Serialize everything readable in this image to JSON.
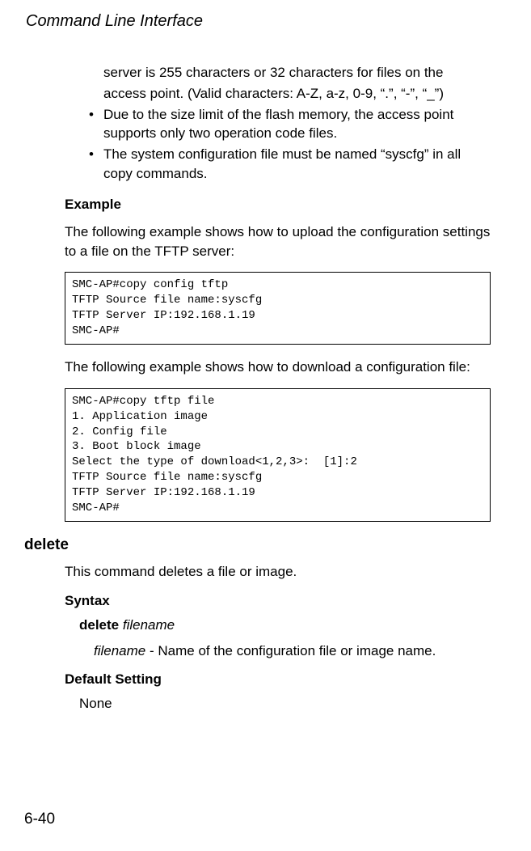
{
  "header": {
    "title": "Command Line Interface"
  },
  "intro": {
    "line1": "server is 255 characters or 32 characters for files on the",
    "line2": "access point. (Valid characters: A-Z, a-z, 0-9, “.”, “-”, “_”)",
    "bullet1": "Due to the size limit of the flash memory, the access point supports only two operation code files.",
    "bullet2": "The system configuration file must be named “syscfg” in all copy commands."
  },
  "example": {
    "heading": "Example",
    "para1": "The following example shows how to upload the configuration settings to a file on the TFTP server:",
    "code1": "SMC-AP#copy config tftp\nTFTP Source file name:syscfg\nTFTP Server IP:192.168.1.19\nSMC-AP#",
    "para2": "The following example shows how to download a configuration file:",
    "code2": "SMC-AP#copy tftp file\n1. Application image\n2. Config file\n3. Boot block image\nSelect the type of download<1,2,3>:  [1]:2\nTFTP Source file name:syscfg\nTFTP Server IP:192.168.1.19\nSMC-AP#"
  },
  "delete": {
    "heading": "delete",
    "desc": "This command deletes a file or image.",
    "syntax_label": "Syntax",
    "syntax_cmd": "delete",
    "syntax_param": "filename",
    "param_name": "filename",
    "param_desc": " - Name of the configuration file or image name.",
    "default_label": "Default Setting",
    "default_value": "None"
  },
  "page_number": "6-40"
}
